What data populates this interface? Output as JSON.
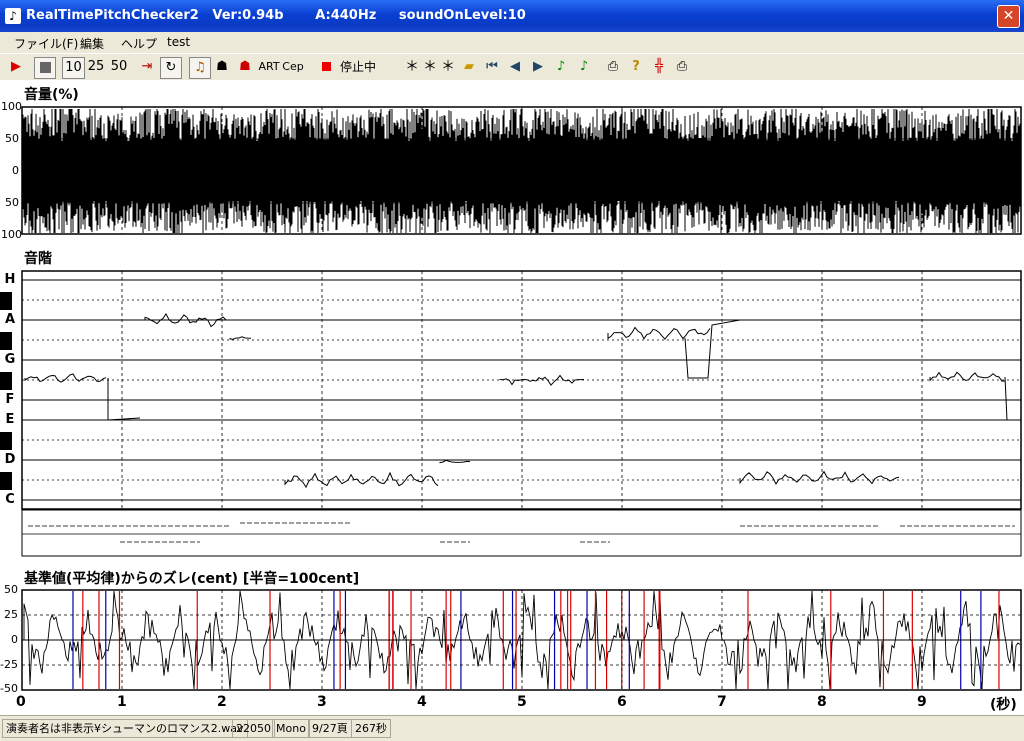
{
  "window": {
    "title": "RealTimePitchChecker2   Ver:0.94b       A:440Hz     soundOnLevel:10",
    "close": "✕"
  },
  "menu": [
    "ファイル(F)",
    "編集",
    "ヘルプ",
    "test"
  ],
  "toolbar": {
    "nums": [
      "10",
      "25",
      "50"
    ],
    "art": "ART",
    "cep": "Cep",
    "state": "停止中",
    "readout": "＊＊＊"
  },
  "volume": {
    "title": "音量(%)",
    "ticks": [
      "100",
      "50",
      "0",
      "50",
      "100"
    ]
  },
  "scale": {
    "title": "音階",
    "notes": [
      "H",
      "A",
      "G",
      "F",
      "E",
      "D",
      "C"
    ]
  },
  "deviation": {
    "title": "基準値(平均律)からのズレ(cent) [半音=100cent]",
    "ticks": [
      "50",
      "25",
      "0",
      "-25",
      "-50"
    ]
  },
  "xaxis": {
    "labels": [
      "0",
      "1",
      "2",
      "3",
      "4",
      "5",
      "6",
      "7",
      "8",
      "9"
    ],
    "unit": "(秒)"
  },
  "status": [
    "演奏者名は非表示¥シューマンのロマンス2.wav",
    "22050",
    "Mono",
    "9/27頁",
    "267秒"
  ]
}
